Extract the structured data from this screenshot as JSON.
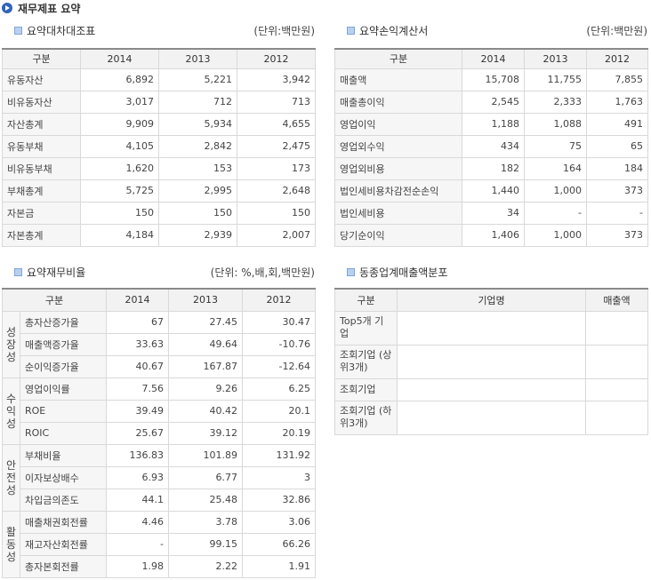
{
  "page_title": "재무제표 요약",
  "balance": {
    "title": "요약대차대조표",
    "unit": "(단위:백만원)",
    "headers": [
      "구분",
      "2014",
      "2013",
      "2012"
    ],
    "rows": [
      {
        "label": "유동자산",
        "v": [
          "6,892",
          "5,221",
          "3,942"
        ]
      },
      {
        "label": "비유동자산",
        "v": [
          "3,017",
          "712",
          "713"
        ]
      },
      {
        "label": "자산총계",
        "v": [
          "9,909",
          "5,934",
          "4,655"
        ]
      },
      {
        "label": "유동부채",
        "v": [
          "4,105",
          "2,842",
          "2,475"
        ]
      },
      {
        "label": "비유동부채",
        "v": [
          "1,620",
          "153",
          "173"
        ]
      },
      {
        "label": "부채총계",
        "v": [
          "5,725",
          "2,995",
          "2,648"
        ]
      },
      {
        "label": "자본금",
        "v": [
          "150",
          "150",
          "150"
        ]
      },
      {
        "label": "자본총계",
        "v": [
          "4,184",
          "2,939",
          "2,007"
        ]
      }
    ]
  },
  "income": {
    "title": "요약손익계산서",
    "unit": "(단위:백만원)",
    "headers": [
      "구분",
      "2014",
      "2013",
      "2012"
    ],
    "rows": [
      {
        "label": "매출액",
        "v": [
          "15,708",
          "11,755",
          "7,855"
        ]
      },
      {
        "label": "매출총이익",
        "v": [
          "2,545",
          "2,333",
          "1,763"
        ]
      },
      {
        "label": "영업이익",
        "v": [
          "1,188",
          "1,088",
          "491"
        ]
      },
      {
        "label": "영업외수익",
        "v": [
          "434",
          "75",
          "65"
        ]
      },
      {
        "label": "영업외비용",
        "v": [
          "182",
          "164",
          "184"
        ]
      },
      {
        "label": "법인세비용차감전순손익",
        "v": [
          "1,440",
          "1,000",
          "373"
        ]
      },
      {
        "label": "법인세비용",
        "v": [
          "34",
          "-",
          "-"
        ]
      },
      {
        "label": "당기순이익",
        "v": [
          "1,406",
          "1,000",
          "373"
        ]
      }
    ]
  },
  "ratio": {
    "title": "요약재무비율",
    "unit": "(단위: %,배,회,백만원)",
    "headers": [
      "구분",
      "2014",
      "2013",
      "2012"
    ],
    "groups": [
      {
        "name": "성장성",
        "rows": [
          {
            "label": "총자산증가율",
            "v": [
              "67",
              "27.45",
              "30.47"
            ]
          },
          {
            "label": "매출액증가율",
            "v": [
              "33.63",
              "49.64",
              "-10.76"
            ]
          },
          {
            "label": "순이익증가율",
            "v": [
              "40.67",
              "167.87",
              "-12.64"
            ]
          }
        ]
      },
      {
        "name": "수익성",
        "rows": [
          {
            "label": "영업이익률",
            "v": [
              "7.56",
              "9.26",
              "6.25"
            ]
          },
          {
            "label": "ROE",
            "v": [
              "39.49",
              "40.42",
              "20.1"
            ]
          },
          {
            "label": "ROIC",
            "v": [
              "25.67",
              "39.12",
              "20.19"
            ]
          }
        ]
      },
      {
        "name": "안전성",
        "rows": [
          {
            "label": "부채비율",
            "v": [
              "136.83",
              "101.89",
              "131.92"
            ]
          },
          {
            "label": "이자보상배수",
            "v": [
              "6.93",
              "6.77",
              "3"
            ]
          },
          {
            "label": "차입금의존도",
            "v": [
              "44.1",
              "25.48",
              "32.86"
            ]
          }
        ]
      },
      {
        "name": "활동성",
        "rows": [
          {
            "label": "매출채권회전률",
            "v": [
              "4.46",
              "3.78",
              "3.06"
            ]
          },
          {
            "label": "재고자산회전률",
            "v": [
              "-",
              "99.15",
              "66.26"
            ]
          },
          {
            "label": "총자본회전률",
            "v": [
              "1.98",
              "2.22",
              "1.91"
            ]
          }
        ]
      }
    ]
  },
  "industry": {
    "title": "동종업계매출액분포",
    "headers": [
      "구분",
      "기업명",
      "매출액"
    ],
    "rows": [
      {
        "label": "Top5개 기업"
      },
      {
        "label": "조회기업 (상위3개)"
      },
      {
        "label": "조회기업"
      },
      {
        "label": "조회기업 (하위3개)"
      }
    ]
  }
}
